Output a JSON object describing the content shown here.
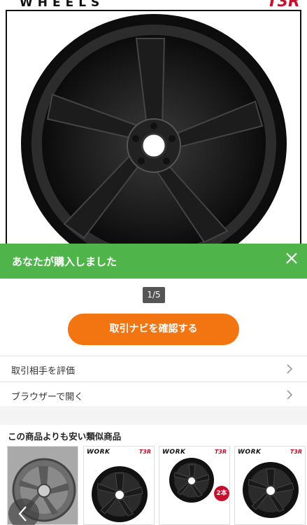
{
  "product_image": {
    "brand_text": "WHEELS",
    "corner_logo": "T3R"
  },
  "banner": {
    "title": "あなたが購入しました",
    "close_icon": "close-icon",
    "color": "#4fb44a"
  },
  "pager": {
    "label": "1/5"
  },
  "cta": {
    "label": "取引ナビを確認する",
    "color": "#f27512"
  },
  "menu": [
    {
      "label": "取引相手を評価"
    },
    {
      "label": "ブラウザーで開く"
    }
  ],
  "similar": {
    "title": "この商品よりも安い類似商品",
    "items": [
      {
        "logo": "",
        "logo_right": ""
      },
      {
        "logo": "WORK",
        "logo_right": "T3R"
      },
      {
        "logo": "WORK",
        "logo_right": "T3R",
        "badge": "2本"
      },
      {
        "logo": "WORK",
        "logo_right": "T3R"
      }
    ]
  }
}
